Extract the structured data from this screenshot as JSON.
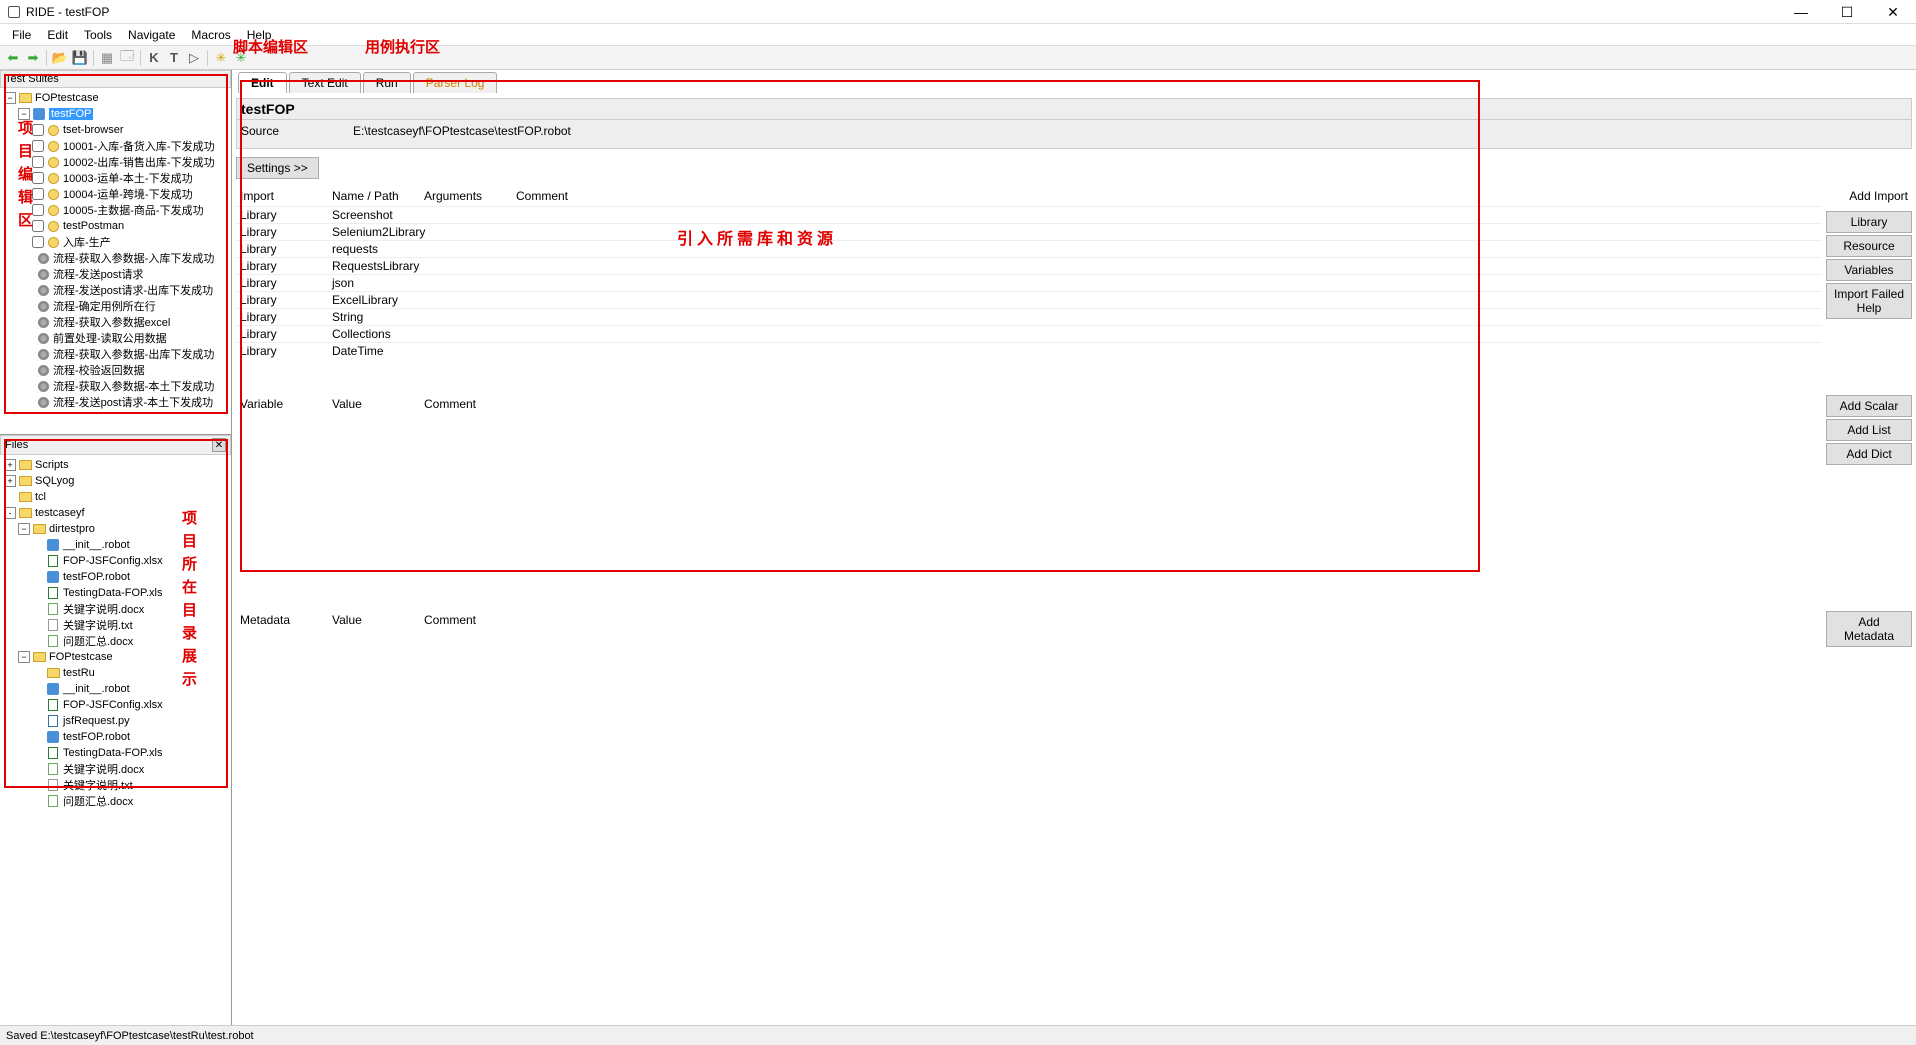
{
  "window": {
    "title": "RIDE - testFOP"
  },
  "menubar": [
    "File",
    "Edit",
    "Tools",
    "Navigate",
    "Macros",
    "Help"
  ],
  "annotations": {
    "script_edit": "脚本编辑区",
    "case_exec": "用例执行区",
    "project_edit": "项目编辑区",
    "import_libs": "引入所需库和资源",
    "project_dir": "项目所在目录展示"
  },
  "panels": {
    "test_suites_header": "Test Suites",
    "files_header": "Files"
  },
  "suites_tree": {
    "root": "FOPtestcase",
    "selected": "testFOP",
    "tests": [
      "tset-browser",
      "10001-入库-备货入库-下发成功",
      "10002-出库-销售出库-下发成功",
      "10003-运单-本土-下发成功",
      "10004-运单-跨境-下发成功",
      "10005-主数据-商品-下发成功",
      "testPostman",
      "入库-生产"
    ],
    "keywords": [
      "流程-获取入参数据-入库下发成功",
      "流程-发送post请求",
      "流程-发送post请求-出库下发成功",
      "流程-确定用例所在行",
      "流程-获取入参数据excel",
      "前置处理-读取公用数据",
      "流程-获取入参数据-出库下发成功",
      "流程-校验返回数据",
      "流程-获取入参数据-本土下发成功",
      "流程-发送post请求-本土下发成功"
    ]
  },
  "files_tree": {
    "top": [
      {
        "name": "Scripts",
        "type": "folder",
        "exp": "+"
      },
      {
        "name": "SQLyog",
        "type": "folder",
        "exp": "+"
      },
      {
        "name": "tcl",
        "type": "folder",
        "exp": ""
      },
      {
        "name": "testcaseyf",
        "type": "folder",
        "exp": "-"
      }
    ],
    "dirtestpro": {
      "name": "dirtestpro",
      "files": [
        {
          "name": "__init__.robot",
          "type": "robot"
        },
        {
          "name": "FOP-JSFConfig.xlsx",
          "type": "xls"
        },
        {
          "name": "testFOP.robot",
          "type": "robot"
        },
        {
          "name": "TestingData-FOP.xls",
          "type": "xls"
        },
        {
          "name": "关键字说明.docx",
          "type": "doc"
        },
        {
          "name": "关键字说明.txt",
          "type": "txt"
        },
        {
          "name": "问题汇总.docx",
          "type": "doc"
        }
      ]
    },
    "foptestcase": {
      "name": "FOPtestcase",
      "testru": "testRu",
      "files": [
        {
          "name": "__init__.robot",
          "type": "robot"
        },
        {
          "name": "FOP-JSFConfig.xlsx",
          "type": "xls"
        },
        {
          "name": "jsfRequest.py",
          "type": "py"
        },
        {
          "name": "testFOP.robot",
          "type": "robot"
        },
        {
          "name": "TestingData-FOP.xls",
          "type": "xls"
        },
        {
          "name": "关键字说明.docx",
          "type": "doc"
        },
        {
          "name": "关键字说明.txt",
          "type": "txt"
        },
        {
          "name": "问题汇总.docx",
          "type": "doc"
        }
      ]
    }
  },
  "tabs": [
    "Edit",
    "Text Edit",
    "Run",
    "Parser Log"
  ],
  "editor": {
    "suite_name": "testFOP",
    "source_label": "Source",
    "source_path": "E:\\testcaseyf\\FOPtestcase\\testFOP.robot",
    "settings_btn": "Settings >>",
    "import_header": {
      "c1": "Import",
      "c2": "Name / Path",
      "c3": "Arguments",
      "c4": "Comment"
    },
    "imports": [
      {
        "type": "Library",
        "name": "Screenshot"
      },
      {
        "type": "Library",
        "name": "Selenium2Library"
      },
      {
        "type": "Library",
        "name": "requests"
      },
      {
        "type": "Library",
        "name": "RequestsLibrary"
      },
      {
        "type": "Library",
        "name": "json"
      },
      {
        "type": "Library",
        "name": "ExcelLibrary"
      },
      {
        "type": "Library",
        "name": "String"
      },
      {
        "type": "Library",
        "name": "Collections"
      },
      {
        "type": "Library",
        "name": "DateTime"
      }
    ],
    "import_side": {
      "label": "Add Import",
      "btns": [
        "Library",
        "Resource",
        "Variables",
        "Import Failed Help"
      ]
    },
    "var_header": {
      "c1": "Variable",
      "c2": "Value",
      "c3": "Comment"
    },
    "var_side": {
      "btns": [
        "Add Scalar",
        "Add List",
        "Add Dict"
      ]
    },
    "meta_header": {
      "c1": "Metadata",
      "c2": "Value",
      "c3": "Comment"
    },
    "meta_side": {
      "btns": [
        "Add Metadata"
      ]
    }
  },
  "statusbar": "Saved E:\\testcaseyf\\FOPtestcase\\testRu\\test.robot"
}
